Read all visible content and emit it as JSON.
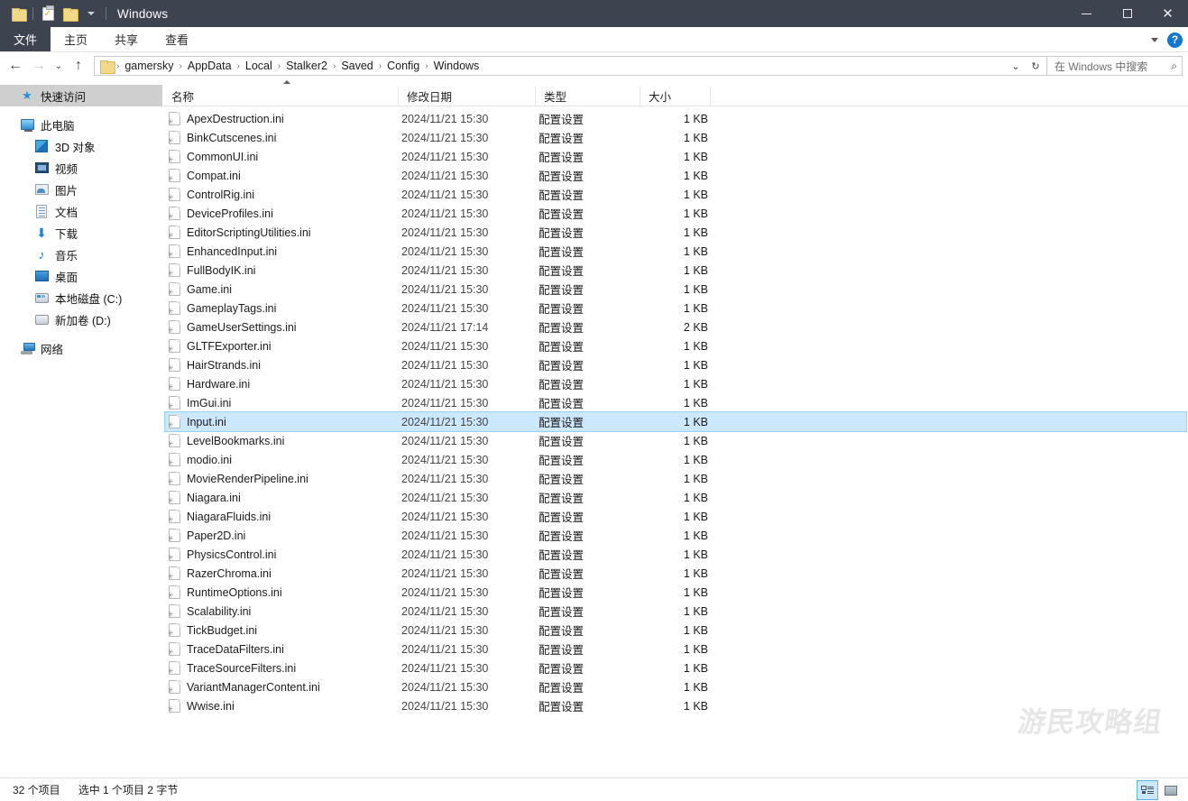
{
  "window": {
    "title": "Windows",
    "quick_access": [
      {
        "name": "folder-icon",
        "label": "属性"
      },
      {
        "name": "properties-icon",
        "label": "属性"
      },
      {
        "name": "new-folder-icon",
        "label": "新建文件夹"
      }
    ],
    "controls": {
      "minimize": "—",
      "maximize": "◻",
      "close": "✕"
    }
  },
  "ribbon": {
    "tabs": [
      {
        "label": "文件",
        "active": true
      },
      {
        "label": "主页",
        "active": false
      },
      {
        "label": "共享",
        "active": false
      },
      {
        "label": "查看",
        "active": false
      }
    ],
    "collapse_icon": "chevron-down-icon",
    "help_label": "?"
  },
  "address": {
    "back_icon": "←",
    "forward_icon": "→",
    "recent_icon": "⌄",
    "up_icon": "↑",
    "breadcrumbs": [
      "gamersky",
      "AppData",
      "Local",
      "Stalker2",
      "Saved",
      "Config",
      "Windows"
    ],
    "separator": "›",
    "dropdown_icon": "⌄",
    "refresh_icon": "↻"
  },
  "search": {
    "placeholder": "在 Windows 中搜索",
    "icon": "search-icon"
  },
  "sidebar": {
    "items": [
      {
        "label": "快速访问",
        "icon": "star-icon",
        "level": 0,
        "selected": true
      },
      {
        "label": "此电脑",
        "icon": "computer-icon",
        "level": 0,
        "selected": false
      },
      {
        "label": "3D 对象",
        "icon": "3d-objects-icon",
        "level": 1,
        "selected": false
      },
      {
        "label": "视频",
        "icon": "videos-icon",
        "level": 1,
        "selected": false
      },
      {
        "label": "图片",
        "icon": "pictures-icon",
        "level": 1,
        "selected": false
      },
      {
        "label": "文档",
        "icon": "documents-icon",
        "level": 1,
        "selected": false
      },
      {
        "label": "下载",
        "icon": "downloads-icon",
        "level": 1,
        "selected": false
      },
      {
        "label": "音乐",
        "icon": "music-icon",
        "level": 1,
        "selected": false
      },
      {
        "label": "桌面",
        "icon": "desktop-icon",
        "level": 1,
        "selected": false
      },
      {
        "label": "本地磁盘 (C:)",
        "icon": "system-drive-icon",
        "level": 1,
        "selected": false
      },
      {
        "label": "新加卷 (D:)",
        "icon": "drive-icon",
        "level": 1,
        "selected": false
      },
      {
        "label": "网络",
        "icon": "network-icon",
        "level": 0,
        "selected": false
      }
    ]
  },
  "file_list": {
    "columns": [
      {
        "key": "name",
        "label": "名称"
      },
      {
        "key": "date",
        "label": "修改日期"
      },
      {
        "key": "type",
        "label": "类型"
      },
      {
        "key": "size",
        "label": "大小"
      }
    ],
    "sort": {
      "column": "名称",
      "direction": "asc"
    },
    "rows": [
      {
        "name": "ApexDestruction.ini",
        "date": "2024/11/21 15:30",
        "type": "配置设置",
        "size": "1 KB",
        "selected": false
      },
      {
        "name": "BinkCutscenes.ini",
        "date": "2024/11/21 15:30",
        "type": "配置设置",
        "size": "1 KB",
        "selected": false
      },
      {
        "name": "CommonUI.ini",
        "date": "2024/11/21 15:30",
        "type": "配置设置",
        "size": "1 KB",
        "selected": false
      },
      {
        "name": "Compat.ini",
        "date": "2024/11/21 15:30",
        "type": "配置设置",
        "size": "1 KB",
        "selected": false
      },
      {
        "name": "ControlRig.ini",
        "date": "2024/11/21 15:30",
        "type": "配置设置",
        "size": "1 KB",
        "selected": false
      },
      {
        "name": "DeviceProfiles.ini",
        "date": "2024/11/21 15:30",
        "type": "配置设置",
        "size": "1 KB",
        "selected": false
      },
      {
        "name": "EditorScriptingUtilities.ini",
        "date": "2024/11/21 15:30",
        "type": "配置设置",
        "size": "1 KB",
        "selected": false
      },
      {
        "name": "EnhancedInput.ini",
        "date": "2024/11/21 15:30",
        "type": "配置设置",
        "size": "1 KB",
        "selected": false
      },
      {
        "name": "FullBodyIK.ini",
        "date": "2024/11/21 15:30",
        "type": "配置设置",
        "size": "1 KB",
        "selected": false
      },
      {
        "name": "Game.ini",
        "date": "2024/11/21 15:30",
        "type": "配置设置",
        "size": "1 KB",
        "selected": false
      },
      {
        "name": "GameplayTags.ini",
        "date": "2024/11/21 15:30",
        "type": "配置设置",
        "size": "1 KB",
        "selected": false
      },
      {
        "name": "GameUserSettings.ini",
        "date": "2024/11/21 17:14",
        "type": "配置设置",
        "size": "2 KB",
        "selected": false
      },
      {
        "name": "GLTFExporter.ini",
        "date": "2024/11/21 15:30",
        "type": "配置设置",
        "size": "1 KB",
        "selected": false
      },
      {
        "name": "HairStrands.ini",
        "date": "2024/11/21 15:30",
        "type": "配置设置",
        "size": "1 KB",
        "selected": false
      },
      {
        "name": "Hardware.ini",
        "date": "2024/11/21 15:30",
        "type": "配置设置",
        "size": "1 KB",
        "selected": false
      },
      {
        "name": "ImGui.ini",
        "date": "2024/11/21 15:30",
        "type": "配置设置",
        "size": "1 KB",
        "selected": false
      },
      {
        "name": "Input.ini",
        "date": "2024/11/21 15:30",
        "type": "配置设置",
        "size": "1 KB",
        "selected": true
      },
      {
        "name": "LevelBookmarks.ini",
        "date": "2024/11/21 15:30",
        "type": "配置设置",
        "size": "1 KB",
        "selected": false
      },
      {
        "name": "modio.ini",
        "date": "2024/11/21 15:30",
        "type": "配置设置",
        "size": "1 KB",
        "selected": false
      },
      {
        "name": "MovieRenderPipeline.ini",
        "date": "2024/11/21 15:30",
        "type": "配置设置",
        "size": "1 KB",
        "selected": false
      },
      {
        "name": "Niagara.ini",
        "date": "2024/11/21 15:30",
        "type": "配置设置",
        "size": "1 KB",
        "selected": false
      },
      {
        "name": "NiagaraFluids.ini",
        "date": "2024/11/21 15:30",
        "type": "配置设置",
        "size": "1 KB",
        "selected": false
      },
      {
        "name": "Paper2D.ini",
        "date": "2024/11/21 15:30",
        "type": "配置设置",
        "size": "1 KB",
        "selected": false
      },
      {
        "name": "PhysicsControl.ini",
        "date": "2024/11/21 15:30",
        "type": "配置设置",
        "size": "1 KB",
        "selected": false
      },
      {
        "name": "RazerChroma.ini",
        "date": "2024/11/21 15:30",
        "type": "配置设置",
        "size": "1 KB",
        "selected": false
      },
      {
        "name": "RuntimeOptions.ini",
        "date": "2024/11/21 15:30",
        "type": "配置设置",
        "size": "1 KB",
        "selected": false
      },
      {
        "name": "Scalability.ini",
        "date": "2024/11/21 15:30",
        "type": "配置设置",
        "size": "1 KB",
        "selected": false
      },
      {
        "name": "TickBudget.ini",
        "date": "2024/11/21 15:30",
        "type": "配置设置",
        "size": "1 KB",
        "selected": false
      },
      {
        "name": "TraceDataFilters.ini",
        "date": "2024/11/21 15:30",
        "type": "配置设置",
        "size": "1 KB",
        "selected": false
      },
      {
        "name": "TraceSourceFilters.ini",
        "date": "2024/11/21 15:30",
        "type": "配置设置",
        "size": "1 KB",
        "selected": false
      },
      {
        "name": "VariantManagerContent.ini",
        "date": "2024/11/21 15:30",
        "type": "配置设置",
        "size": "1 KB",
        "selected": false
      },
      {
        "name": "Wwise.ini",
        "date": "2024/11/21 15:30",
        "type": "配置设置",
        "size": "1 KB",
        "selected": false
      }
    ]
  },
  "watermark": {
    "text": "游民攻略组"
  },
  "status": {
    "item_count": "32 个项目",
    "selection": "选中 1 个项目  2 字节",
    "views": [
      {
        "name": "details-view",
        "active": true
      },
      {
        "name": "large-icons-view",
        "active": false
      }
    ]
  },
  "colors": {
    "titlebar": "#3d4450",
    "selection": "#cce8ff",
    "accent": "#1177d1"
  }
}
